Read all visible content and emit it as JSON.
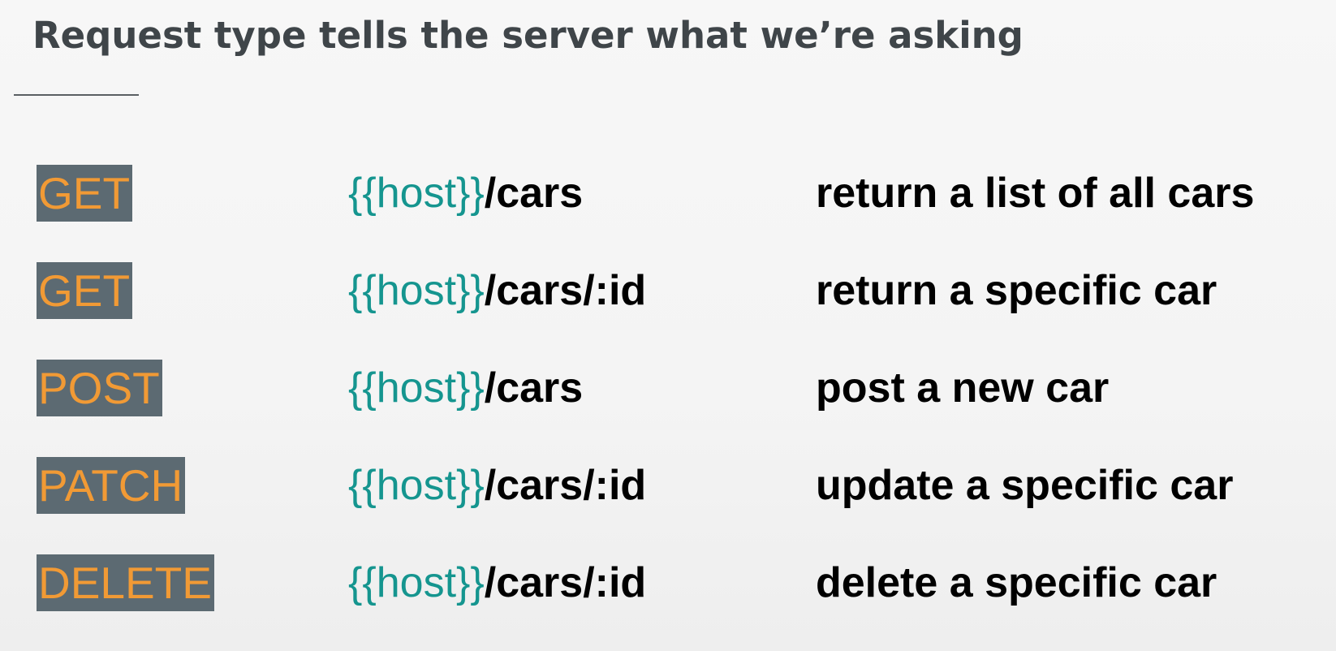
{
  "slide": {
    "title": "Request type tells the server what we’re asking"
  },
  "rows": [
    {
      "method": "GET",
      "host": "{{host}}",
      "path": "/cars",
      "description": "return a list of all cars"
    },
    {
      "method": "GET",
      "host": "{{host}}",
      "path": "/cars/:id",
      "description": "return a specific car"
    },
    {
      "method": "POST",
      "host": "{{host}}",
      "path": "/cars",
      "description": "post a new car"
    },
    {
      "method": "PATCH",
      "host": "{{host}}",
      "path": "/cars/:id",
      "description": "update a specific car"
    },
    {
      "method": "DELETE",
      "host": "{{host}}",
      "path": "/cars/:id",
      "description": "delete a specific car"
    }
  ],
  "colors": {
    "badge_background": "#5c6a72",
    "method_text": "#f19a35",
    "host_placeholder": "#15958f",
    "title_text": "#3f4549"
  }
}
